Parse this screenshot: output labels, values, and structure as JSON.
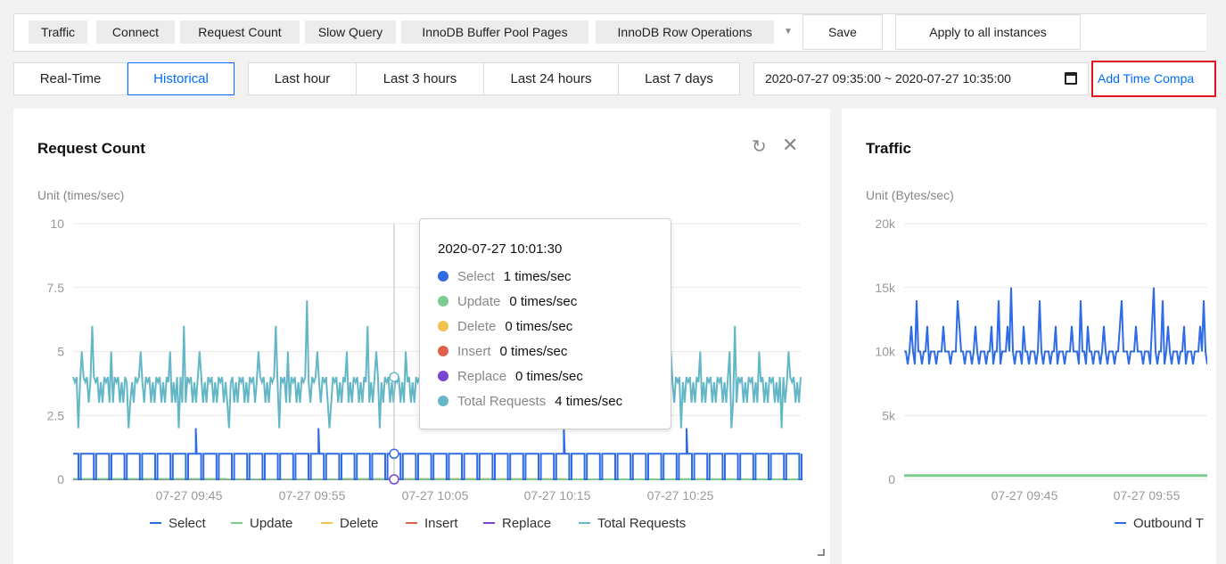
{
  "toolbar": {
    "metric_tags": [
      "Traffic",
      "Connect",
      "Request Count",
      "Slow Query",
      "InnoDB Buffer Pool Pages",
      "InnoDB Row Operations"
    ],
    "save_label": "Save",
    "apply_label": "Apply to all instances"
  },
  "time_filter": {
    "modes": [
      "Real-Time",
      "Historical"
    ],
    "active_mode": "Historical",
    "ranges": [
      "Last hour",
      "Last 3 hours",
      "Last 24 hours",
      "Last 7 days"
    ],
    "date_range": "2020-07-27 09:35:00 ~ 2020-07-27 10:35:00",
    "add_compare_label": "Add Time Compa"
  },
  "colors": {
    "accent": "#006eff",
    "highlight_border": "#e0141e"
  },
  "cards": {
    "request_count": {
      "title": "Request Count",
      "unit": "Unit (times/sec)",
      "refresh_icon": "refresh-icon",
      "close_icon": "close-icon",
      "tooltip": {
        "time": "2020-07-27 10:01:30",
        "rows": [
          {
            "name": "Select",
            "value": "1 times/sec",
            "color": "#2f6be5"
          },
          {
            "name": "Update",
            "value": "0 times/sec",
            "color": "#7dcc8f"
          },
          {
            "name": "Delete",
            "value": "0 times/sec",
            "color": "#f2c14e"
          },
          {
            "name": "Insert",
            "value": "0 times/sec",
            "color": "#e0604c"
          },
          {
            "name": "Replace",
            "value": "0 times/sec",
            "color": "#7a45cf"
          },
          {
            "name": "Total Requests",
            "value": "4 times/sec",
            "color": "#63b7c6"
          }
        ]
      }
    },
    "traffic": {
      "title": "Traffic",
      "unit": "Unit (Bytes/sec)",
      "legend_partial": "Outbound T"
    }
  },
  "chart_data": [
    {
      "type": "line",
      "title": "Request Count",
      "ylabel": "Unit (times/sec)",
      "ylim": [
        0,
        10
      ],
      "yticks": [
        "0",
        "2.5",
        "5",
        "7.5",
        "10"
      ],
      "xticks": [
        "07-27 09:45",
        "07-27 09:55",
        "07-27 10:05",
        "07-27 10:15",
        "07-27 10:25"
      ],
      "grid": true,
      "legend": "bottom",
      "series": [
        {
          "name": "Select",
          "color": "#2f6be5",
          "typical": 1,
          "spike": 2,
          "note_values": "oscillates between 0 and 1 with occasional spikes to 2"
        },
        {
          "name": "Update",
          "color": "#7dcc8f",
          "typical": 0
        },
        {
          "name": "Delete",
          "color": "#f2c14e",
          "typical": 0
        },
        {
          "name": "Insert",
          "color": "#e0604c",
          "typical": 0
        },
        {
          "name": "Replace",
          "color": "#7a45cf",
          "typical": 0
        },
        {
          "name": "Total Requests",
          "color": "#63b7c6",
          "typical": 3.5,
          "low": 3,
          "high": 4,
          "spikes": [
            5,
            6,
            7,
            8
          ]
        }
      ],
      "highlight": {
        "time": "2020-07-27 10:01:30",
        "select": 1,
        "total": 4
      }
    },
    {
      "type": "line",
      "title": "Traffic",
      "ylabel": "Unit (Bytes/sec)",
      "ylim": [
        0,
        20000
      ],
      "yticks": [
        "0",
        "5k",
        "10k",
        "15k",
        "20k"
      ],
      "xticks": [
        "07-27 09:45",
        "07-27 09:55"
      ],
      "grid": true,
      "legend": "bottom",
      "series": [
        {
          "name": "Outbound T",
          "color": "#2f6be5",
          "typical": 10000,
          "spikes": [
            12000,
            14000,
            15000
          ]
        },
        {
          "name": "",
          "color": "#7dcc8f",
          "typical": 300
        }
      ]
    }
  ]
}
